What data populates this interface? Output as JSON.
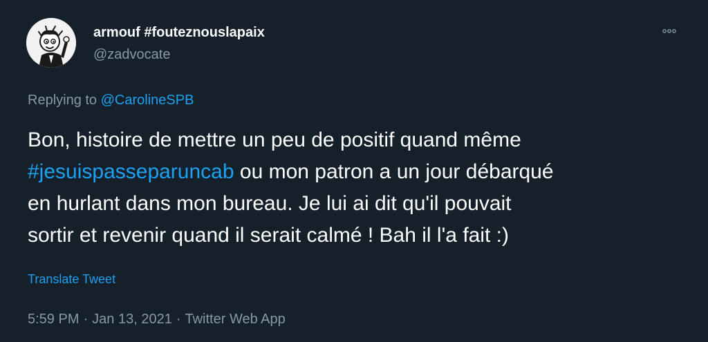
{
  "tweet": {
    "display_name": "armouf #fouteznouslapaix",
    "handle": "@zadvocate",
    "replying_prefix": "Replying to ",
    "replying_to": "@CarolineSPB",
    "text_line1": "Bon, histoire de mettre un peu de positif quand même",
    "hashtag": "#jesuispasseparuncab",
    "text_line2_rest": " ou mon patron a un jour débarqué",
    "text_line3": "en hurlant dans mon bureau. Je lui ai dit qu'il pouvait",
    "text_line4": "sortir et revenir quand il serait calmé ! Bah il l'a fait :)",
    "translate_label": "Translate Tweet",
    "time": "5:59 PM",
    "date": "Jan 13, 2021",
    "source": "Twitter Web App",
    "separator": "·"
  },
  "icons": {
    "more": "more-horizontal-icon"
  },
  "colors": {
    "background": "#15202b",
    "text": "#ffffff",
    "secondary_text": "#8899a6",
    "accent": "#1da1f2"
  }
}
